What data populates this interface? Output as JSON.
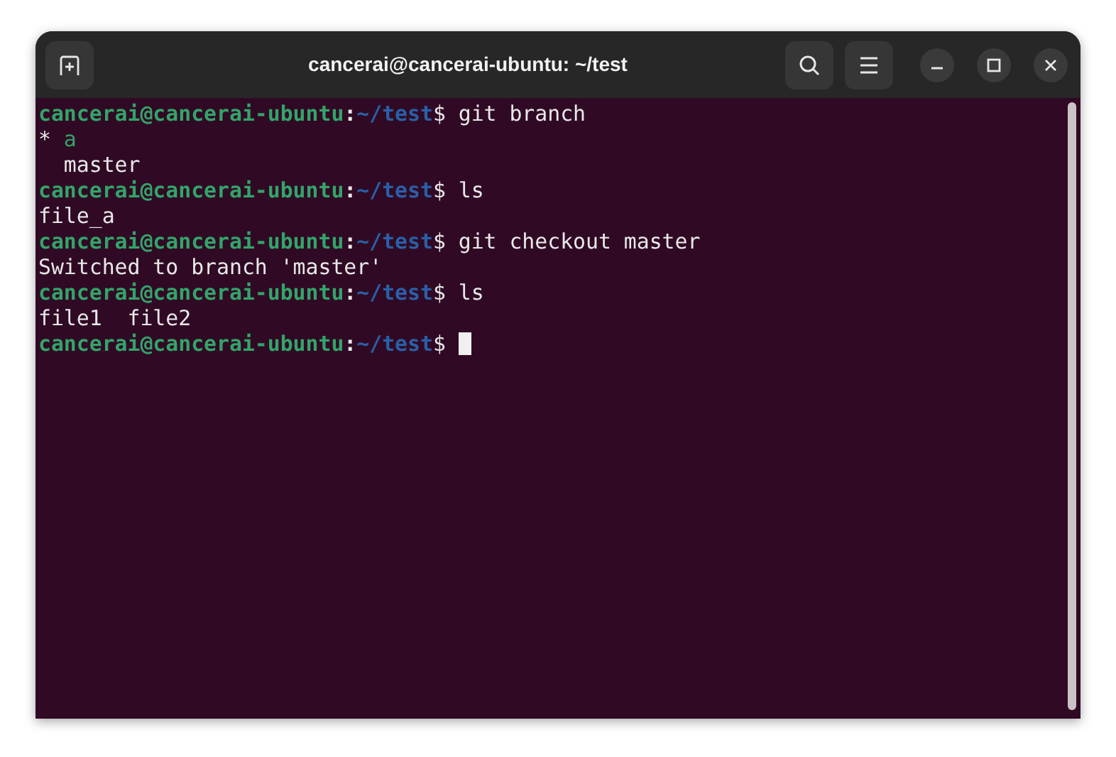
{
  "window": {
    "title": "cancerai@cancerai-ubuntu: ~/test"
  },
  "terminal": {
    "lines": [
      {
        "kind": "prompt",
        "user_host": "cancerai@cancerai-ubuntu",
        "separator": ":",
        "path": "~/test",
        "symbol": "$",
        "command": "git branch",
        "cursor": false
      },
      {
        "kind": "branch",
        "marker": "*",
        "name": "a",
        "current": true
      },
      {
        "kind": "branch",
        "name": "master",
        "current": false
      },
      {
        "kind": "prompt",
        "user_host": "cancerai@cancerai-ubuntu",
        "separator": ":",
        "path": "~/test",
        "symbol": "$",
        "command": "ls",
        "cursor": false
      },
      {
        "kind": "output",
        "text": "file_a"
      },
      {
        "kind": "prompt",
        "user_host": "cancerai@cancerai-ubuntu",
        "separator": ":",
        "path": "~/test",
        "symbol": "$",
        "command": "git checkout master",
        "cursor": false
      },
      {
        "kind": "output",
        "text": "Switched to branch 'master'"
      },
      {
        "kind": "prompt",
        "user_host": "cancerai@cancerai-ubuntu",
        "separator": ":",
        "path": "~/test",
        "symbol": "$",
        "command": "ls",
        "cursor": false
      },
      {
        "kind": "output",
        "text": "file1  file2"
      },
      {
        "kind": "prompt",
        "user_host": "cancerai@cancerai-ubuntu",
        "separator": ":",
        "path": "~/test",
        "symbol": "$",
        "cursor": true
      }
    ]
  }
}
